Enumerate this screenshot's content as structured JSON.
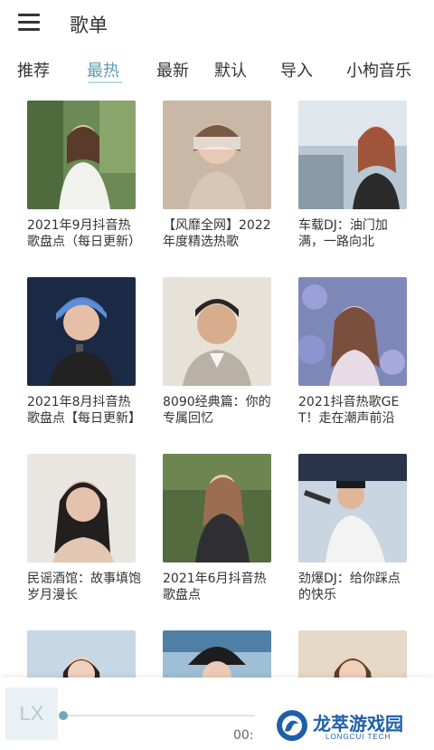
{
  "header": {
    "title": "歌单",
    "menu_icon": "hamburger-menu-icon"
  },
  "tabs": [
    {
      "label": "推荐"
    },
    {
      "label": "最热",
      "active": true
    },
    {
      "label": "最新"
    },
    {
      "label": "默认"
    },
    {
      "label": "导入"
    },
    {
      "label": "小枸音乐"
    }
  ],
  "colors": {
    "accent": "#5b9bb0",
    "underline": "#b9dde6",
    "text": "#333333"
  },
  "playlists": [
    {
      "title": "2021年9月抖音热歌盘点（每日更新）"
    },
    {
      "title": "【风靡全网】2022年度精选热歌"
    },
    {
      "title": "车载DJ：油门加满，一路向北"
    },
    {
      "title": "2021年8月抖音热歌盘点【每日更新】"
    },
    {
      "title": "8090经典篇：你的专属回忆"
    },
    {
      "title": "2021抖音热歌GET！走在潮声前沿"
    },
    {
      "title": "民谣酒馆：故事填饱岁月漫长"
    },
    {
      "title": "2021年6月抖音热歌盘点"
    },
    {
      "title": "劲爆DJ：给你踩点的快乐"
    },
    {
      "title": ""
    },
    {
      "title": ""
    },
    {
      "title": ""
    }
  ],
  "player": {
    "cover_text": "LX",
    "time": "00:",
    "progress": 0
  },
  "watermark": {
    "name": "龙萃游戏园",
    "sub": "LONGCUI TECH"
  }
}
